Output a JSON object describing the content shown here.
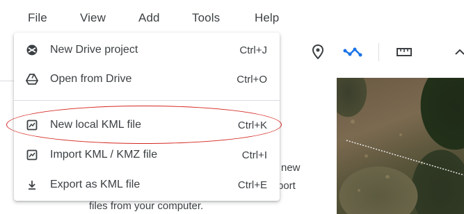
{
  "menubar": {
    "items": [
      "File",
      "View",
      "Add",
      "Tools",
      "Help"
    ]
  },
  "file_menu": {
    "items": [
      {
        "label": "New Drive project",
        "shortcut": "Ctrl+J",
        "icon": "drive-project-icon"
      },
      {
        "label": "Open from Drive",
        "shortcut": "Ctrl+O",
        "icon": "google-drive-icon"
      },
      {
        "label": "New local KML file",
        "shortcut": "Ctrl+K",
        "icon": "kml-file-icon"
      },
      {
        "label": "Import KML / KMZ file",
        "shortcut": "Ctrl+I",
        "icon": "kml-file-icon"
      },
      {
        "label": "Export as KML file",
        "shortcut": "Ctrl+E",
        "icon": "download-icon"
      }
    ]
  },
  "toolbar": {
    "icons": [
      "placemark-icon",
      "path-icon",
      "ruler-icon",
      "chevron-up-icon"
    ]
  },
  "panel": {
    "fragment_new": "new",
    "fragment_port": "port",
    "fragment_files": "files from your computer."
  },
  "colors": {
    "highlight": "#d4261f",
    "path_icon": "#1a73e8",
    "text": "#3c4043"
  }
}
